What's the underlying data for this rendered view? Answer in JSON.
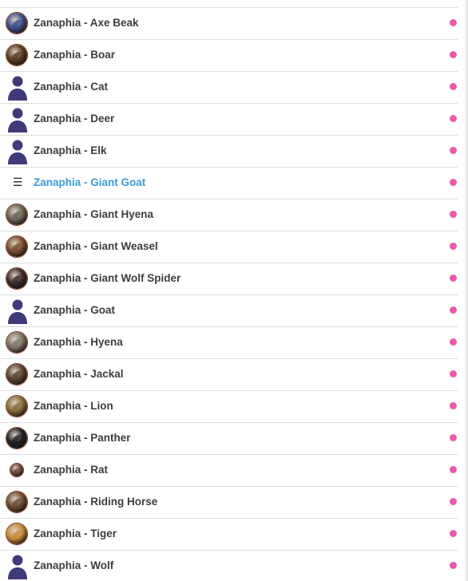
{
  "colors": {
    "text": "#3d3d3d",
    "active_text": "#3a9bd9",
    "status_dot": "#e85aad",
    "divider": "#dcdcdc",
    "silhouette": "#3f3a7a"
  },
  "list": {
    "items": [
      {
        "label": "Zanaphia - Axe Beak",
        "avatar": "token",
        "tint": "#3c4e8a"
      },
      {
        "label": "Zanaphia - Boar",
        "avatar": "token",
        "tint": "#5a3a22"
      },
      {
        "label": "Zanaphia - Cat",
        "avatar": "silhouette"
      },
      {
        "label": "Zanaphia - Deer",
        "avatar": "silhouette"
      },
      {
        "label": "Zanaphia - Elk",
        "avatar": "silhouette"
      },
      {
        "label": "Zanaphia - Giant Goat",
        "avatar": "list-icon",
        "active": true
      },
      {
        "label": "Zanaphia - Giant Hyena",
        "avatar": "token",
        "tint": "#6b6454"
      },
      {
        "label": "Zanaphia - Giant Weasel",
        "avatar": "token",
        "tint": "#7a4a2e"
      },
      {
        "label": "Zanaphia - Giant Wolf Spider",
        "avatar": "token",
        "tint": "#3a2a2a"
      },
      {
        "label": "Zanaphia - Goat",
        "avatar": "silhouette"
      },
      {
        "label": "Zanaphia - Hyena",
        "avatar": "token",
        "tint": "#7d7566"
      },
      {
        "label": "Zanaphia - Jackal",
        "avatar": "token",
        "tint": "#5a4232"
      },
      {
        "label": "Zanaphia - Lion",
        "avatar": "token",
        "tint": "#8a6a3a"
      },
      {
        "label": "Zanaphia - Panther",
        "avatar": "token",
        "tint": "#1e1e24"
      },
      {
        "label": "Zanaphia - Rat",
        "avatar": "token-small",
        "tint": "#6a4a3a"
      },
      {
        "label": "Zanaphia - Riding Horse",
        "avatar": "token",
        "tint": "#6e4a30"
      },
      {
        "label": "Zanaphia - Tiger",
        "avatar": "token",
        "tint": "#c88a3a"
      },
      {
        "label": "Zanaphia - Wolf",
        "avatar": "silhouette"
      }
    ]
  }
}
